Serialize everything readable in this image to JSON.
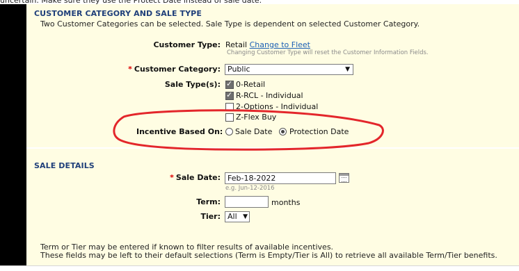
{
  "top_text": "uncertain. Make sure they use the Protect Date instead of sale date.",
  "customer_section": {
    "title": "CUSTOMER CATEGORY AND SALE TYPE",
    "description": "Two Customer Categories can be selected. Sale Type is dependent on selected Customer Category.",
    "customer_type": {
      "label": "Customer Type:",
      "value": "Retail",
      "change_link": "Change to Fleet",
      "hint": "Changing Customer Type will reset the Customer Information Fields."
    },
    "customer_category": {
      "required": "*",
      "label": "Customer Category:",
      "selected": "Public"
    },
    "sale_types": {
      "label": "Sale Type(s):",
      "options": [
        {
          "label": "0-Retail",
          "checked": true
        },
        {
          "label": "R-RCL - Individual",
          "checked": true
        },
        {
          "label": "2-Options - Individual",
          "checked": false
        },
        {
          "label": "Z-Flex Buy",
          "checked": false
        }
      ]
    },
    "incentive": {
      "label": "Incentive Based On:",
      "options": [
        {
          "label": "Sale Date",
          "selected": false
        },
        {
          "label": "Protection Date",
          "selected": true
        }
      ]
    }
  },
  "sale_section": {
    "title": "SALE DETAILS",
    "sale_date": {
      "required": "*",
      "label": "Sale Date:",
      "value": "Feb-18-2022",
      "hint": "e.g. Jun-12-2016"
    },
    "term": {
      "label": "Term:",
      "value": "",
      "unit": "months"
    },
    "tier": {
      "label": "Tier:",
      "selected": "All"
    },
    "notes": [
      "Term or Tier may be entered if known to filter results of available incentives.",
      "These fields may be left to their default selections (Term is Empty/Tier is All) to retrieve all available Term/Tier benefits."
    ]
  },
  "annotation_color": "#e3262b"
}
